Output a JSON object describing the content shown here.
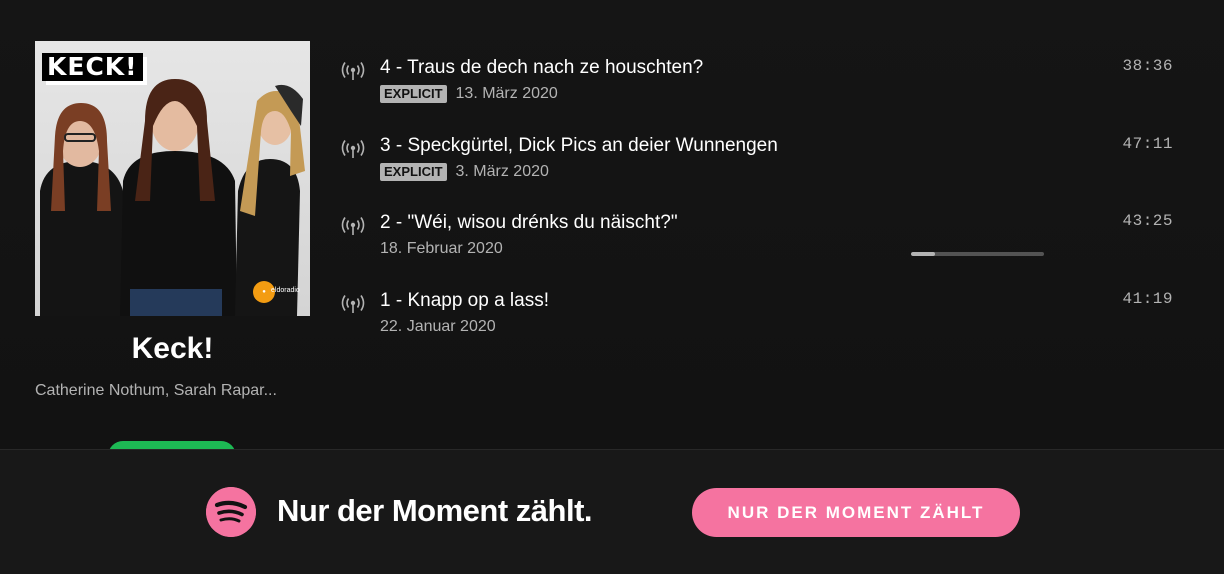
{
  "show": {
    "cover_logo": "KECK!",
    "title": "Keck!",
    "authors": "Catherine Nothum, Sarah Rapar...",
    "cover_badge": "eldoradio"
  },
  "episodes": [
    {
      "title": "4 - Traus de dech nach ze houschten?",
      "explicit": "EXPLICIT",
      "date": "13. März 2020",
      "duration": "38:36"
    },
    {
      "title": "3 - Speckgürtel, Dick Pics an deier Wunnengen",
      "explicit": "EXPLICIT",
      "date": "3. März 2020",
      "duration": "47:11"
    },
    {
      "title": "2 - \"Wéi, wisou drénks du näischt?\"",
      "date": "18. Februar 2020",
      "duration": "43:25",
      "progress": 0.18
    },
    {
      "title": "1 - Knapp op a lass!",
      "date": "22. Januar 2020",
      "duration": "41:19"
    }
  ],
  "banner": {
    "headline": "Nur der Moment zählt.",
    "cta_label": "NUR DER MOMENT ZÄHLT",
    "accent": "#f573a0"
  },
  "colors": {
    "background": "#121212",
    "follow_green": "#1db954"
  }
}
